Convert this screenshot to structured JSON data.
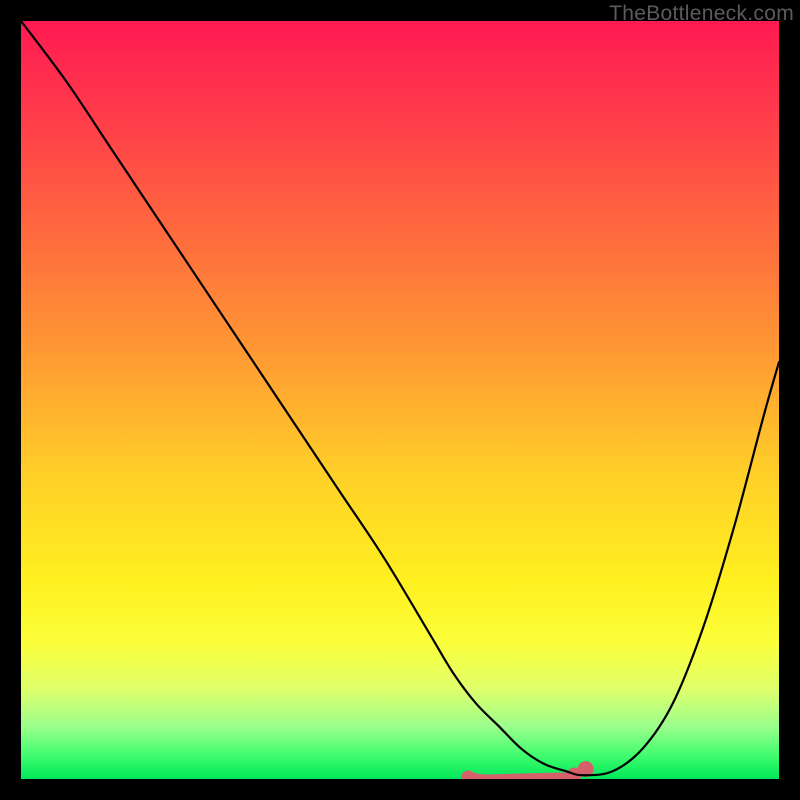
{
  "watermark": "TheBottleneck.com",
  "chart_data": {
    "type": "line",
    "title": "",
    "xlabel": "",
    "ylabel": "",
    "xlim": [
      0,
      100
    ],
    "ylim": [
      0,
      100
    ],
    "grid": false,
    "legend": false,
    "series": [
      {
        "name": "curve",
        "x": [
          0,
          6,
          12,
          18,
          24,
          30,
          36,
          42,
          48,
          54,
          57,
          60,
          63,
          66,
          69,
          72,
          74,
          78,
          82,
          86,
          90,
          94,
          98,
          100
        ],
        "values": [
          100,
          92,
          83,
          74,
          65,
          56,
          47,
          38,
          29,
          19,
          14,
          10,
          7,
          4,
          2,
          1,
          0.5,
          1,
          4,
          10,
          20,
          33,
          48,
          55
        ]
      }
    ],
    "markers": [
      {
        "name": "highlight-segment",
        "x0": 59,
        "x1": 73,
        "y": 0.6,
        "color": "#d4606a"
      },
      {
        "name": "highlight-dot",
        "x": 74.5,
        "y": 1.3,
        "color": "#d4606a"
      }
    ],
    "background_gradient": {
      "direction": "vertical",
      "stops": [
        {
          "pos": 0,
          "color": "#ff1a52"
        },
        {
          "pos": 60,
          "color": "#ffd028"
        },
        {
          "pos": 100,
          "color": "#00e85a"
        }
      ]
    }
  }
}
